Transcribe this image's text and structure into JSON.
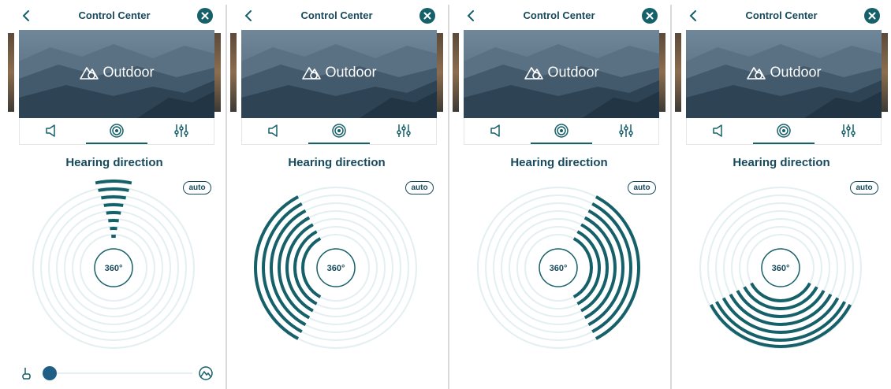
{
  "panels": [
    {
      "header_title": "Control Center",
      "program": "Outdoor",
      "section_title": "Hearing direction",
      "auto_label": "auto",
      "center_label": "360°",
      "direction": "front",
      "tabs": [
        "volume-tab",
        "direction-tab",
        "equalizer-tab"
      ],
      "active_tab": "direction-tab",
      "slider": {
        "value": 0
      }
    },
    {
      "header_title": "Control Center",
      "program": "Outdoor",
      "section_title": "Hearing direction",
      "auto_label": "auto",
      "center_label": "360°",
      "direction": "left",
      "tabs": [
        "volume-tab",
        "direction-tab",
        "equalizer-tab"
      ],
      "active_tab": "direction-tab"
    },
    {
      "header_title": "Control Center",
      "program": "Outdoor",
      "section_title": "Hearing direction",
      "auto_label": "auto",
      "center_label": "360°",
      "direction": "right",
      "tabs": [
        "volume-tab",
        "direction-tab",
        "equalizer-tab"
      ],
      "active_tab": "direction-tab"
    },
    {
      "header_title": "Control Center",
      "program": "Outdoor",
      "section_title": "Hearing direction",
      "auto_label": "auto",
      "center_label": "360°",
      "direction": "back",
      "tabs": [
        "volume-tab",
        "direction-tab",
        "equalizer-tab"
      ],
      "active_tab": "direction-tab"
    }
  ],
  "colors": {
    "accent": "#16606a",
    "title": "#174a5c",
    "ring": "#e3eff0",
    "slider_thumb": "#1f5f86"
  }
}
